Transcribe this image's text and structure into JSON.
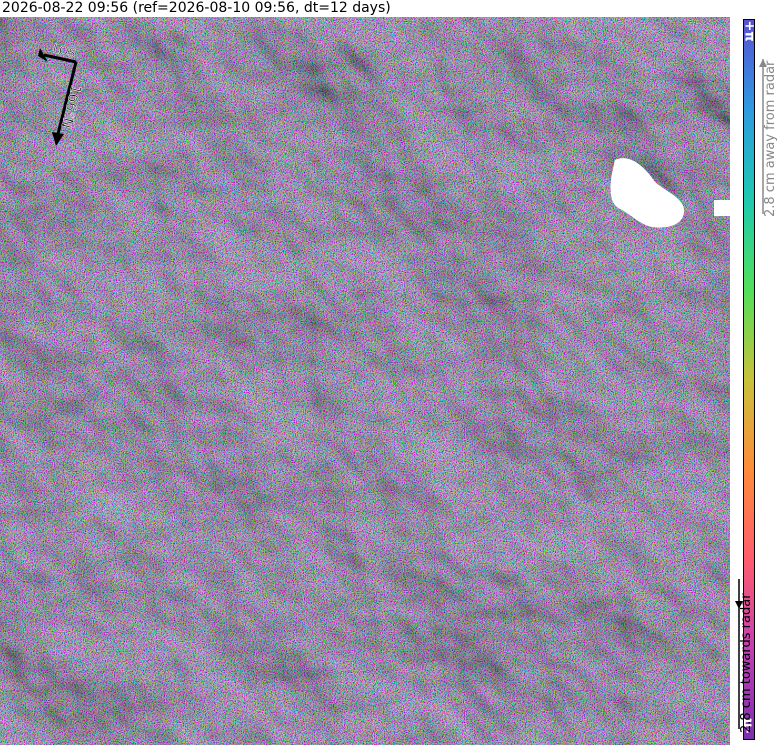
{
  "title": "2026-08-22 09:56 (ref=2026-08-10 09:56, dt=12 days)",
  "compass": {
    "los_label": "LOS",
    "heading_label": "166°N"
  },
  "colorbar": {
    "top_label": "+π",
    "bottom_label": "-π",
    "away_label": "2.8 cm away from radar",
    "towards_label": "2.8 cm towards radar",
    "colors": [
      "#7a2fb0",
      "#c23fb3",
      "#ff5d6e",
      "#ff8c3a",
      "#c7c23a",
      "#52e05a",
      "#1fc9b0",
      "#2e9be0",
      "#5a4fd4"
    ]
  },
  "image": {
    "type": "wrapped-interferogram-over-hillshade",
    "masked_area_color": "#ffffff"
  }
}
